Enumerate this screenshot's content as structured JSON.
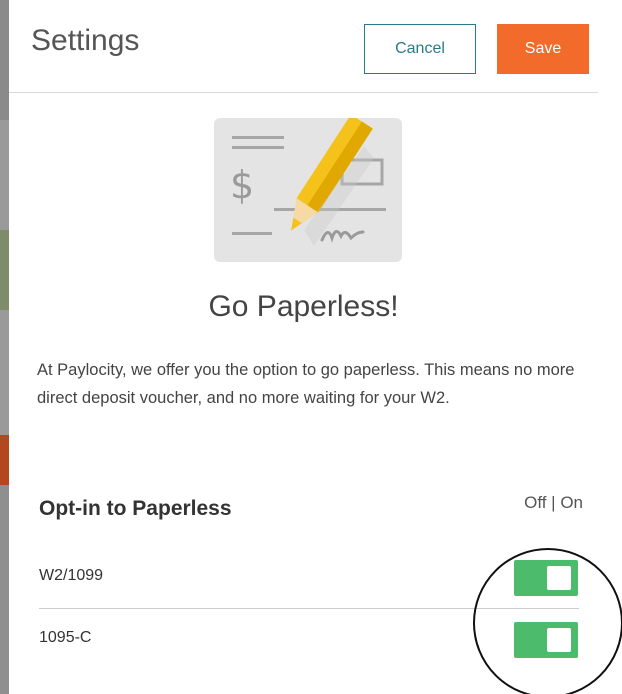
{
  "header": {
    "title": "Settings",
    "cancel_label": "Cancel",
    "save_label": "Save"
  },
  "main": {
    "heading": "Go Paperless!",
    "description": "At Paylocity, we offer you the option to go paperless. This means no more direct deposit voucher, and no more waiting for your W2.",
    "section_title": "Opt-in to Paperless",
    "toggle_legend": "Off | On",
    "items": [
      {
        "label": "W2/1099",
        "enabled": true
      },
      {
        "label": "1095-C",
        "enabled": true
      }
    ]
  },
  "colors": {
    "accent_teal": "#2b7a8c",
    "save_orange": "#f26b2b",
    "toggle_green": "#4cbb6c",
    "pencil_yellow": "#f5c21b"
  },
  "icons": {
    "illustration": "check-with-pencil-icon"
  }
}
